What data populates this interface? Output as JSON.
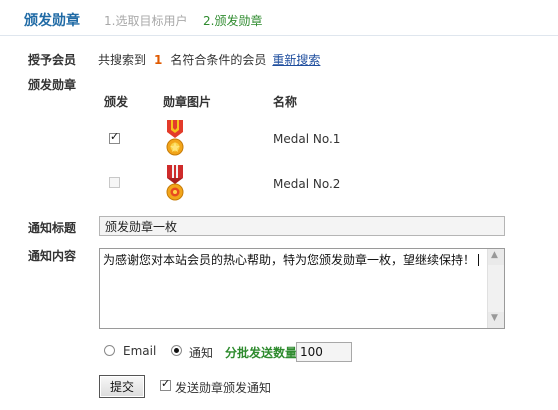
{
  "header": {
    "title": "颁发勋章",
    "step1": "1.选取目标用户",
    "step2": "2.颁发勋章"
  },
  "form": {
    "grant_member_label": "授予会员",
    "search_prefix": "共搜索到",
    "search_count": "1",
    "search_suffix": "名符合条件的会员",
    "research_link": "重新搜索",
    "medal_label": "颁发勋章",
    "table_headers": {
      "issue": "颁发",
      "image": "勋章图片",
      "name": "名称"
    },
    "medals": [
      {
        "name": "Medal No.1",
        "checked": true
      },
      {
        "name": "Medal No.2",
        "checked": false
      }
    ],
    "notice_title_label": "通知标题",
    "notice_title_value": "颁发勋章一枚",
    "notice_content_label": "通知内容",
    "notice_content_value": "为感谢您对本站会员的热心帮助，特为您颁发勋章一枚，望继续保持！",
    "option_email": "Email",
    "option_notice": "通知",
    "batch_label": "分批发送数量",
    "batch_value": "100",
    "submit_label": "提交",
    "send_notice_label": "发送勋章颁发通知"
  },
  "colors": {
    "title_blue": "#1f6aa5",
    "step_active_green": "#2e8b2e",
    "count_orange": "#e05a00",
    "link_blue": "#1f4e9e"
  },
  "icons": {
    "medal1": "medal-ribbon-yellow-icon",
    "medal2": "medal-ribbon-red-icon"
  }
}
